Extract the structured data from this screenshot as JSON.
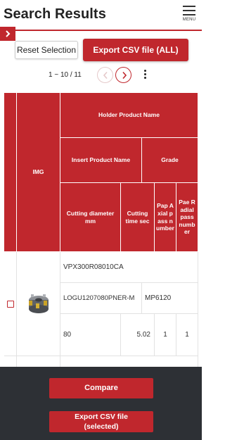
{
  "header": {
    "title": "Search Results",
    "menu_label": "MENU",
    "accent_color": "#c0272d"
  },
  "sidebar_toggle": {
    "icon": "chevron-right-icon"
  },
  "toolbar": {
    "reset_label": "Reset Selection",
    "export_all_label": "Export CSV file (ALL)"
  },
  "pagination": {
    "label": "1 ~ 10 / 11",
    "prev_icon": "chevron-left-icon",
    "next_icon": "chevron-right-icon",
    "more_icon": "more-vertical-icon"
  },
  "table": {
    "headers": {
      "img": "IMG",
      "holder": "Holder Product Name",
      "insert": "Insert Product Name",
      "grade": "Grade",
      "cutting_diameter": "Cutting diameter mm",
      "cutting_time": "Cutting time sec",
      "axial_passes": "Pap Axial pass number",
      "radial_passes": "Pae Radial pass number"
    },
    "rows": [
      {
        "selected": false,
        "image": "milling-cutter-image",
        "holder": "VPX300R08010CA",
        "insert": "LOGU1207080PNER-M",
        "grade": "MP6120",
        "cutting_diameter": "80",
        "cutting_time": "5.02",
        "axial_passes": "1",
        "radial_passes": "1"
      }
    ]
  },
  "footer": {
    "compare_label": "Compare",
    "export_selected_line1": "Export CSV file",
    "export_selected_line2": "(selected)"
  }
}
